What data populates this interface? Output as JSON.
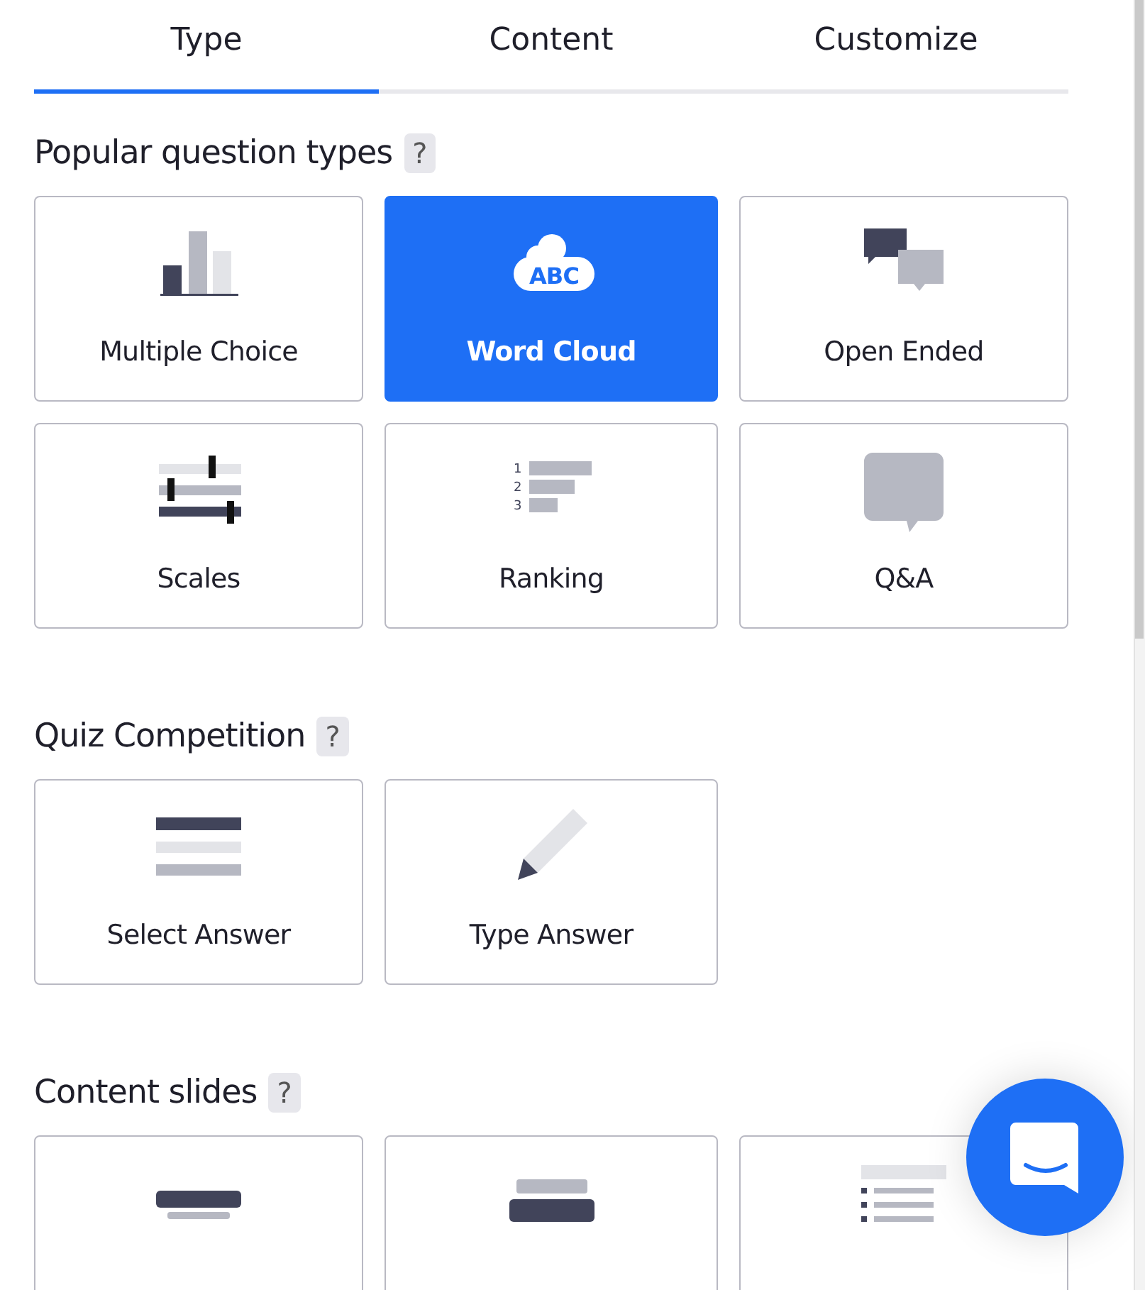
{
  "tabs": [
    {
      "label": "Type",
      "selected": true
    },
    {
      "label": "Content",
      "selected": false
    },
    {
      "label": "Customize",
      "selected": false
    }
  ],
  "sections": [
    {
      "title": "Popular question types",
      "help": "?",
      "cards": [
        {
          "kind": "bars",
          "label": "Multiple Choice",
          "selected": false
        },
        {
          "kind": "cloud",
          "label": "Word Cloud",
          "selected": true,
          "icon_text": "ABC"
        },
        {
          "kind": "bubbles",
          "label": "Open Ended",
          "selected": false
        },
        {
          "kind": "scales",
          "label": "Scales",
          "selected": false
        },
        {
          "kind": "ranking",
          "label": "Ranking",
          "selected": false,
          "icon_text": [
            "1",
            "2",
            "3"
          ]
        },
        {
          "kind": "speech",
          "label": "Q&A",
          "selected": false
        }
      ]
    },
    {
      "title": "Quiz Competition",
      "help": "?",
      "cards": [
        {
          "kind": "lines",
          "label": "Select Answer",
          "selected": false
        },
        {
          "kind": "pencil",
          "label": "Type Answer",
          "selected": false
        }
      ]
    },
    {
      "title": "Content slides",
      "help": "?",
      "cards": [
        {
          "kind": "heading",
          "selected": false
        },
        {
          "kind": "paragraph",
          "selected": false
        },
        {
          "kind": "bullets",
          "selected": false
        }
      ]
    }
  ]
}
